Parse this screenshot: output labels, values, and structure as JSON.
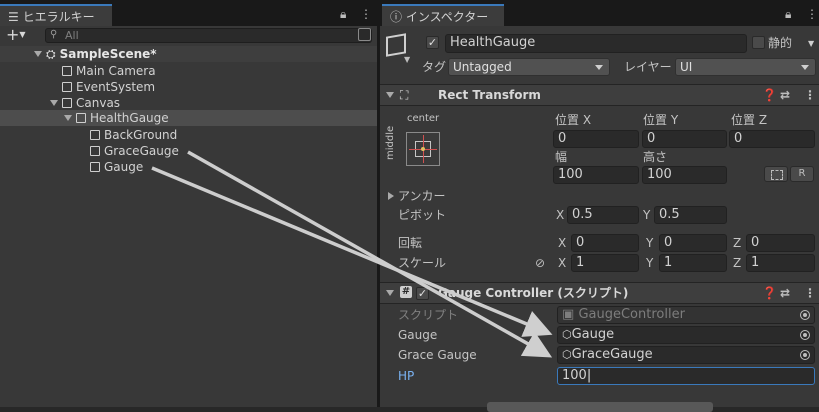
{
  "hierarchy": {
    "tab_label": "ヒエラルキー",
    "add_button": "+",
    "search_placeholder": "All",
    "rows": [
      {
        "label": "SampleScene*"
      },
      {
        "label": "Main Camera"
      },
      {
        "label": "EventSystem"
      },
      {
        "label": "Canvas"
      },
      {
        "label": "HealthGauge"
      },
      {
        "label": "BackGround"
      },
      {
        "label": "GraceGauge"
      },
      {
        "label": "Gauge"
      }
    ]
  },
  "inspector": {
    "tab_label": "インスペクター",
    "object_name": "HealthGauge",
    "active_checked": "✓",
    "static_label": "静的",
    "tag_label": "タグ",
    "tag_value": "Untagged",
    "layer_label": "レイヤー",
    "layer_value": "UI",
    "rect_transform": {
      "title": "Rect Transform",
      "anchor_h": "center",
      "anchor_v": "middle",
      "pos_x_label": "位置 X",
      "pos_y_label": "位置 Y",
      "pos_z_label": "位置 Z",
      "pos_x": "0",
      "pos_y": "0",
      "pos_z": "0",
      "width_label": "幅",
      "height_label": "高さ",
      "width": "100",
      "height": "100",
      "r_button": "R",
      "anchor_label": "アンカー",
      "pivot_label": "ピボット",
      "pivot_x_label": "X",
      "pivot_x": "0.5",
      "pivot_y_label": "Y",
      "pivot_y": "0.5",
      "rotation_label": "回転",
      "rot_x": "0",
      "rot_y": "0",
      "rot_z": "0",
      "scale_label": "スケール",
      "scale_x": "1",
      "scale_y": "1",
      "scale_z": "1",
      "axis_x": "X",
      "axis_y": "Y",
      "axis_z": "Z"
    },
    "gauge_controller": {
      "title": "Gauge Controller (スクリプト)",
      "script_label": "スクリプト",
      "script_value": "GaugeController",
      "gauge_label": "Gauge",
      "gauge_value": "Gauge",
      "grace_label": "Grace Gauge",
      "grace_value": "GraceGauge",
      "hp_label": "HP",
      "hp_value": "100"
    }
  }
}
